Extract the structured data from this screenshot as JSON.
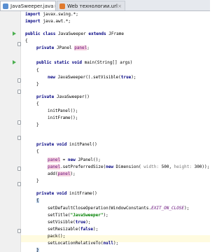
{
  "tabs": [
    {
      "label": "JavaSweeper.java",
      "close": "×"
    },
    {
      "label": "Web технологии.url",
      "close": "×"
    }
  ],
  "code": {
    "l1_kw": "import",
    "l1_rest": " javax.swing.*;",
    "l2_kw": "import",
    "l2_rest": " java.awt.*;",
    "l3_kw1": "public",
    "l3_kw2": " class",
    "l3_name": " JavaSweeper",
    "l3_kw3": " extends",
    "l3_rest": " JFrame",
    "l4": "{",
    "l5_kw": "private",
    "l5_type": " JPanel ",
    "l5_field": "panel",
    "l5_end": ";",
    "l6_kw1": "public",
    "l6_kw2": " static",
    "l6_kw3": " void",
    "l6_rest": " main(String[] args)",
    "l7": "{",
    "l8_kw": "new",
    "l8_mid": " JavaSweeper().setVisible(",
    "l8_lit": "true",
    "l8_end": ");",
    "l9": "}",
    "l10_kw": "private",
    "l10_rest": " JavaSweeper()",
    "l11": "{",
    "l12": "initPanel();",
    "l13": "initFrame();",
    "l14": "}",
    "l15_kw1": "private",
    "l15_kw2": " void",
    "l15_rest": " initPanel()",
    "l16": "{",
    "l17_field": "panel",
    "l17_mid": " = ",
    "l17_kw": "new",
    "l17_rest": " JPanel();",
    "l18_field": "panel",
    "l18_mid": ".setPreferredSize(",
    "l18_kw": "new",
    "l18_mid2": " Dimension( ",
    "l18_hint1": "width:",
    "l18_num1": " 500",
    "l18_sep": ", ",
    "l18_hint2": "height:",
    "l18_num2": " 300",
    "l18_end": "));",
    "l19_pre": "add(",
    "l19_field": "panel",
    "l19_end": ");",
    "l20": "}",
    "l21_kw1": "private",
    "l21_kw2": " void",
    "l21_rest": " initFrame()",
    "l22": "{",
    "l23_pre": "setDefaultCloseOperation(WindowConstants.",
    "l23_const": "EXIT_ON_CLOSE",
    "l23_end": ");",
    "l24_pre": "setTitle(",
    "l24_str": "\"JavaSweeper\"",
    "l24_end": ");",
    "l25_pre": "setVisible(",
    "l25_lit": "true",
    "l25_end": ");",
    "l26_pre": "setResizable(",
    "l26_lit": "false",
    "l26_end": ");",
    "l27": "pack();",
    "l28_pre": "setLocationRelativeTo(",
    "l28_lit": "null",
    "l28_end": ");",
    "l29": "}",
    "l30": "}"
  },
  "colors": {
    "keyword": "#000080",
    "string": "#008000",
    "field": "#660e7a",
    "hint": "#787878",
    "current_line": "#fffbe0",
    "run_icon": "#4caf50"
  }
}
